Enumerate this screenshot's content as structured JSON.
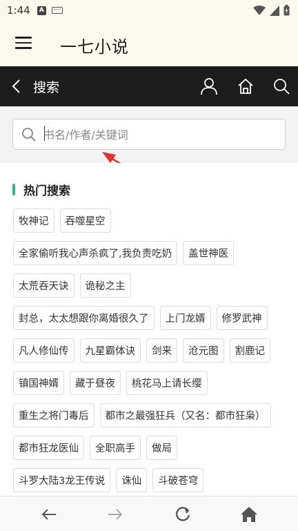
{
  "status_bar": {
    "time": "1:44",
    "notif_letter": "A"
  },
  "app_bar": {
    "title": "一七小说"
  },
  "toolbar": {
    "title": "搜索"
  },
  "search": {
    "placeholder": "书名/作者/关键词",
    "value": ""
  },
  "hot": {
    "title": "热门搜索",
    "accent_color": "#2ab79a",
    "rows": [
      [
        "牧神记",
        "吞噬星空"
      ],
      [
        "全家偷听我心声杀疯了,我负责吃奶",
        "盖世神医"
      ],
      [
        "太荒吞天诀",
        "诡秘之主"
      ],
      [
        "封总，太太想跟你离婚很久了",
        "上门龙婿",
        "修罗武神"
      ],
      [
        "凡人修仙传",
        "九星霸体诀",
        "剑来",
        "沧元图",
        "割鹿记"
      ],
      [
        "镇国神婿",
        "藏于昼夜",
        "桃花马上请长缨"
      ],
      [
        "重生之将门毒后",
        "都市之最强狂兵（又名：都市狂枭）"
      ],
      [
        "都市狂龙医仙",
        "全职高手",
        "做局"
      ],
      [
        "斗罗大陆3龙王传说",
        "诛仙",
        "斗破苍穹"
      ]
    ]
  },
  "colors": {
    "toolbar_bg": "#1d1d1d",
    "appbar_bg": "#fbf8ee",
    "annotation": "#e8312b"
  },
  "icons": [
    "menu-icon",
    "back-chevron-icon",
    "user-icon",
    "home-icon",
    "search-icon",
    "arrow-left-icon",
    "arrow-right-icon",
    "refresh-icon",
    "home-icon"
  ]
}
